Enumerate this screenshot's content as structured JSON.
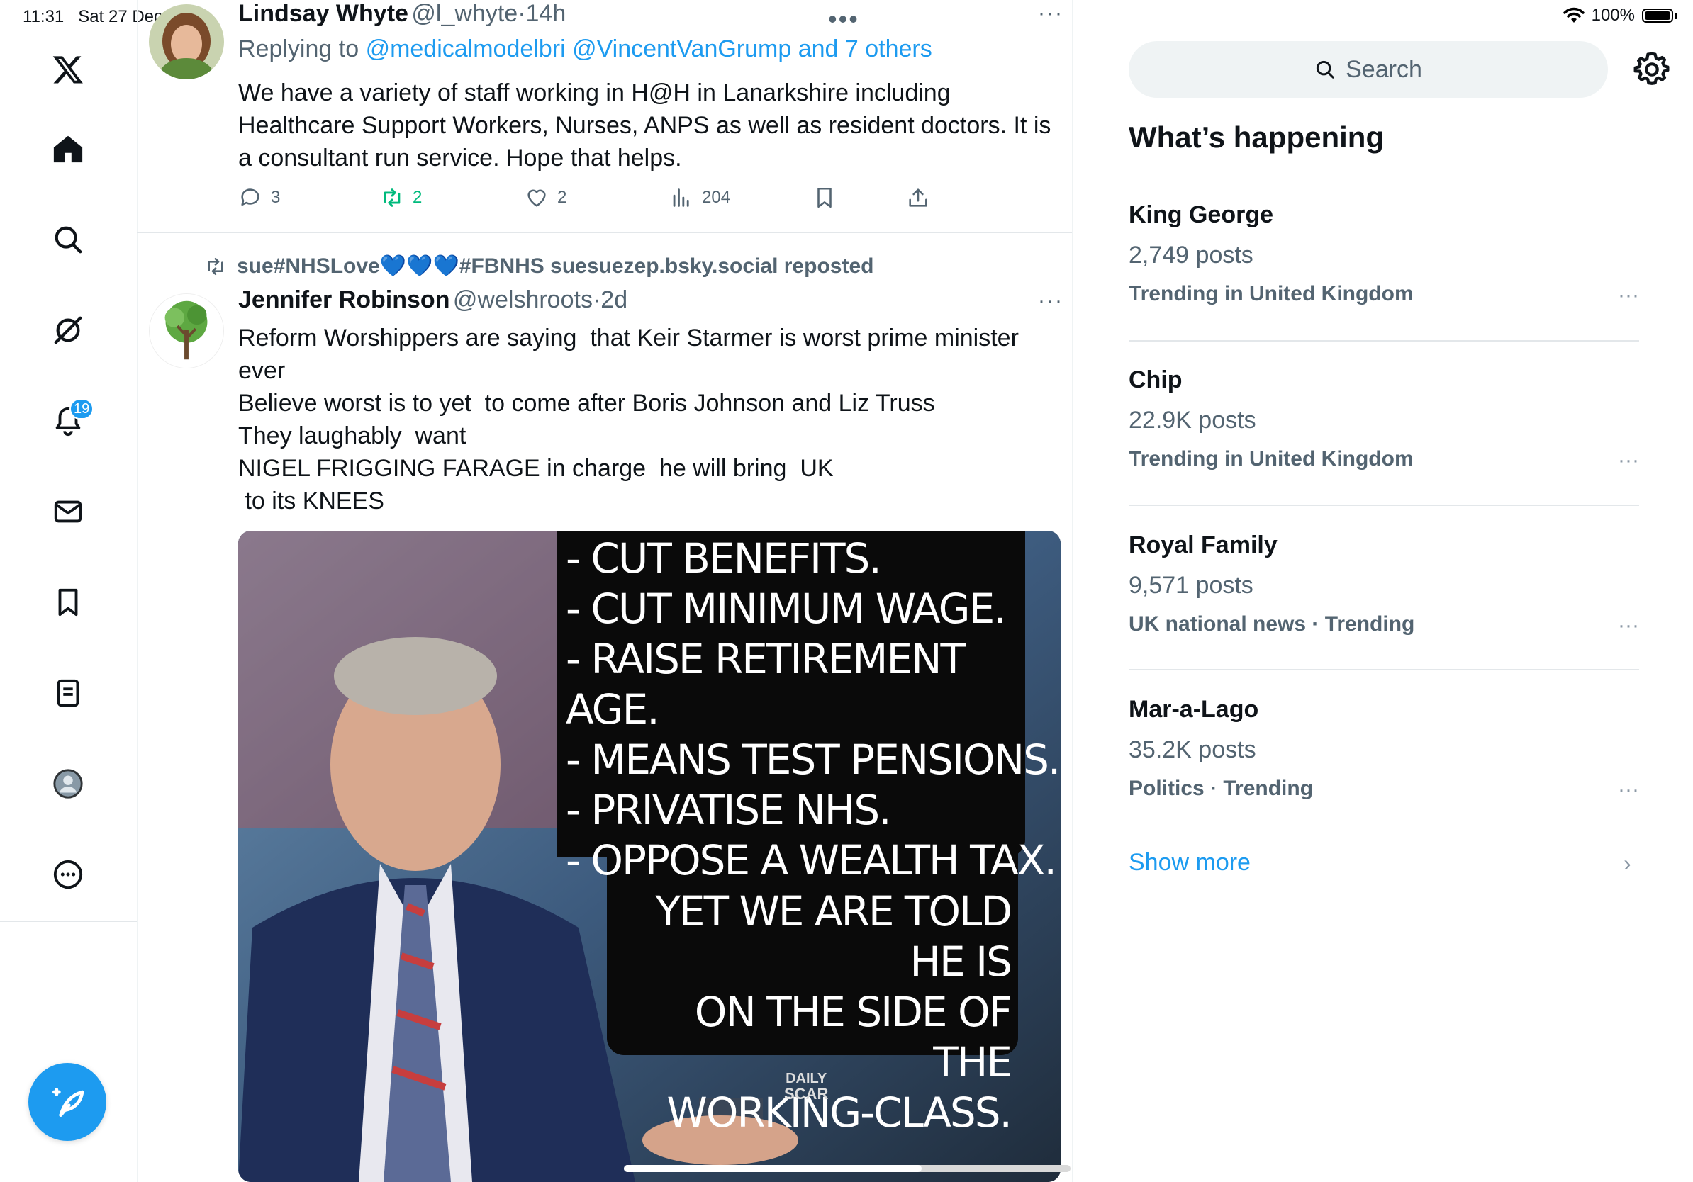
{
  "status_bar": {
    "time": "11:31",
    "date": "Sat 27 Dec",
    "battery": "100%"
  },
  "nav": {
    "notifications_badge": "19",
    "icons": [
      "x-logo-icon",
      "home-icon",
      "search-icon",
      "grok-icon",
      "bell-icon",
      "mail-icon",
      "bookmark-icon",
      "lists-icon",
      "profile-icon",
      "more-icon",
      "compose-icon"
    ]
  },
  "tweet1": {
    "name": "Lindsay Whyte",
    "handle": "@l_whyte",
    "time": "14h",
    "replying_prefix": "Replying to",
    "replying_to": "@medicalmodelbri @VincentVanGrump and 7 others",
    "text": "We have a variety of staff working in H@H in Lanarkshire including\nHealthcare Support Workers, Nurses, ANPS as well as resident doctors. It is\na consultant run service. Hope that helps.",
    "replies": "3",
    "reposts": "2",
    "likes": "2",
    "views": "204"
  },
  "tweet2": {
    "reposted_by": "sue#NHSLove💙💙💙#FBNHS suesuezep.bsky.social reposted",
    "name": "Jennifer Robinson",
    "handle": "@welshroots",
    "time": "2d",
    "text": "Reform Worshippers are saying  that Keir Starmer is worst prime minister\never\nBelieve worst is to yet  to come after Boris Johnson and Liz Truss\nThey laughably  want\nNIGEL FRIGGING FARAGE in charge  he will bring  UK\n to its KNEES",
    "image": {
      "bullets": [
        "- CUT BENEFITS.",
        "- CUT MINIMUM WAGE.",
        "- RAISE RETIREMENT AGE.",
        "- MEANS TEST PENSIONS.",
        "- PRIVATISE NHS.",
        "- OPPOSE A WEALTH TAX."
      ],
      "footer_lines": [
        "YET WE ARE TOLD HE IS",
        "ON THE SIDE OF THE",
        "WORKING-CLASS."
      ],
      "watermark_line1": "DAILY",
      "watermark_line2": "SCAR"
    }
  },
  "right": {
    "search_placeholder": "Search",
    "section_title": "What’s happening",
    "trends": [
      {
        "title": "King George",
        "count": "2,749 posts",
        "context": "Trending in United Kingdom"
      },
      {
        "title": "Chip",
        "count": "22.9K posts",
        "context": "Trending in United Kingdom"
      },
      {
        "title": "Royal Family",
        "count": "9,571 posts",
        "context": "UK national news · Trending"
      },
      {
        "title": "Mar-a-Lago",
        "count": "35.2K posts",
        "context": "Politics · Trending"
      }
    ],
    "show_more": "Show more"
  },
  "colors": {
    "accent": "#1d9bf0",
    "repost_green": "#00ba7c",
    "muted": "#536471"
  }
}
